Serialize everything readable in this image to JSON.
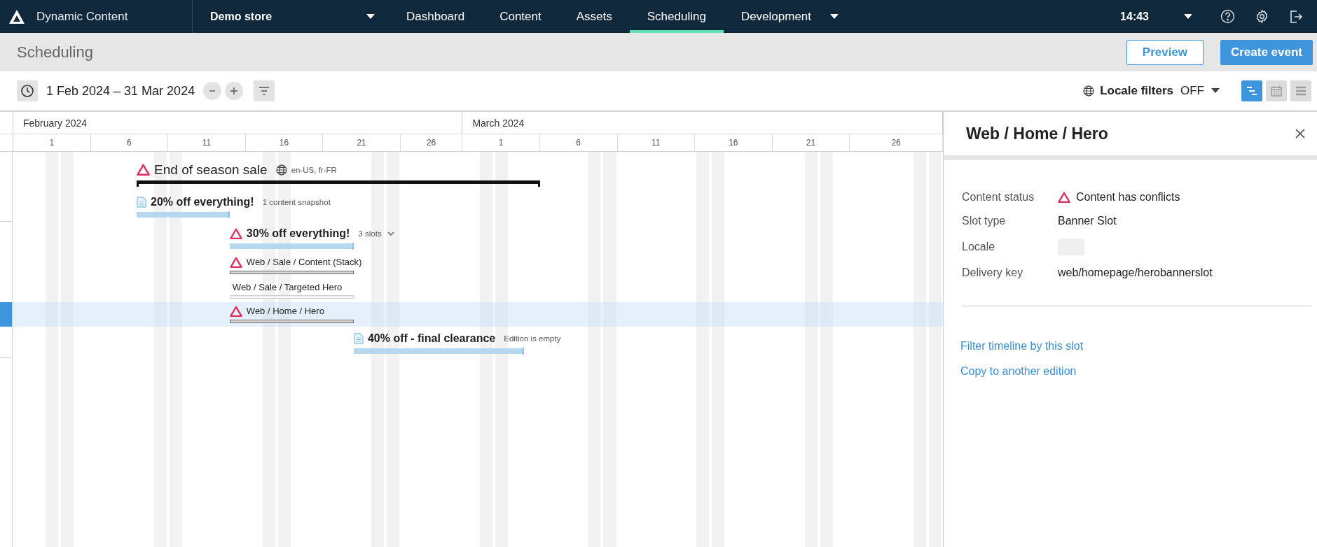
{
  "app": {
    "name": "Dynamic Content",
    "store": "Demo store",
    "time": "14:43",
    "nav": [
      {
        "label": "Dashboard",
        "selected": false
      },
      {
        "label": "Content",
        "selected": false
      },
      {
        "label": "Assets",
        "selected": false
      },
      {
        "label": "Scheduling",
        "selected": true
      },
      {
        "label": "Development",
        "selected": false
      }
    ]
  },
  "page": {
    "title": "Scheduling",
    "buttons": [
      {
        "label": "Preview",
        "kind": "secondary"
      },
      {
        "label": "Create event",
        "kind": "primary"
      }
    ]
  },
  "toolbar": {
    "date_range": "1 Feb 2024 – 31 Mar 2024",
    "locale_label": "Locale filters",
    "locale_value": "OFF",
    "views": [
      {
        "kind": "timeline",
        "selected": true
      },
      {
        "kind": "calendar",
        "selected": false
      },
      {
        "kind": "list",
        "selected": false
      }
    ]
  },
  "timeline": {
    "months": [
      {
        "label": "February 2024",
        "ticks": [
          "1",
          "6",
          "11",
          "16",
          "21",
          "26"
        ]
      },
      {
        "label": "March 2024",
        "ticks": [
          "1",
          "6",
          "11",
          "16",
          "21",
          "26"
        ]
      }
    ],
    "rows": [
      {
        "kind": "event",
        "title": "End of season sale",
        "conflict": true,
        "locales": "en-US, fr-FR",
        "selected": false
      },
      {
        "kind": "edition",
        "title": "20% off everything!",
        "conflict": false,
        "note": "1 content snapshot",
        "selected": false
      },
      {
        "kind": "edition",
        "title": "30% off everything!",
        "conflict": true,
        "note": "3 slots",
        "expanded": true,
        "selected": false
      },
      {
        "kind": "slot",
        "title": "Web / Sale / Content (Stack)",
        "conflict": true,
        "selected": false
      },
      {
        "kind": "slot",
        "title": "Web / Sale / Targeted Hero",
        "conflict": false,
        "selected": false
      },
      {
        "kind": "slot",
        "title": "Web / Home / Hero",
        "conflict": true,
        "selected": true
      },
      {
        "kind": "edition",
        "title": "40% off - final clearance",
        "conflict": false,
        "note": "Edition is empty",
        "selected": false
      }
    ]
  },
  "panel": {
    "title": "Web / Home / Hero",
    "fields": [
      {
        "label": "Content status",
        "kind": "status",
        "value": "Content has conflicts"
      },
      {
        "label": "Slot type",
        "kind": "text",
        "value": "Banner Slot"
      },
      {
        "label": "Locale",
        "kind": "chip"
      },
      {
        "label": "Delivery key",
        "kind": "text",
        "value": "web/homepage/herobannerslot"
      }
    ],
    "links": [
      "Filter timeline by this slot",
      "Copy to another edition"
    ]
  }
}
